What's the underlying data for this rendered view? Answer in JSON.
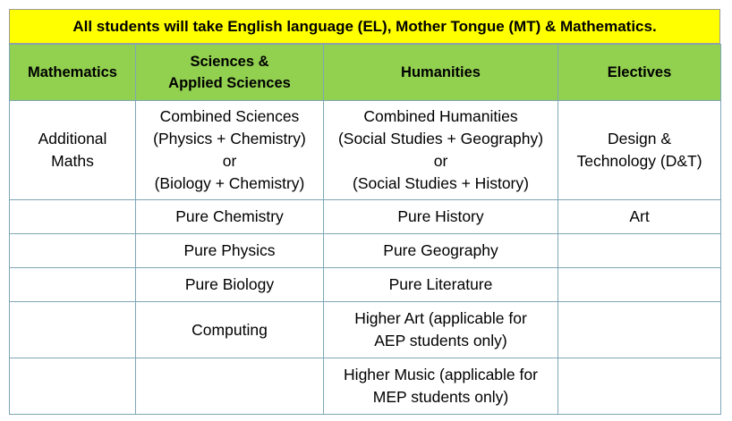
{
  "banner": {
    "text": "All students will take English language (EL), Mother Tongue (MT) & Mathematics."
  },
  "table": {
    "headers": {
      "mathematics": "Mathematics",
      "sciences_line1": "Sciences &",
      "sciences_line2": "Applied Sciences",
      "humanities": "Humanities",
      "electives": "Electives"
    },
    "rows": [
      {
        "mathematics": [
          "Additional",
          "Maths"
        ],
        "sciences": [
          "Combined Sciences",
          "(Physics + Chemistry)",
          "or",
          "(Biology + Chemistry)"
        ],
        "humanities": [
          "Combined Humanities",
          "(Social Studies + Geography)",
          "or",
          "(Social Studies + History)"
        ],
        "electives": [
          "Design &",
          "Technology (D&T)"
        ]
      },
      {
        "mathematics": "",
        "sciences": "Pure Chemistry",
        "humanities": "Pure History",
        "electives": "Art"
      },
      {
        "mathematics": "",
        "sciences": "Pure Physics",
        "humanities": "Pure Geography",
        "electives": ""
      },
      {
        "mathematics": "",
        "sciences": "Pure Biology",
        "humanities": "Pure Literature",
        "electives": ""
      },
      {
        "mathematics": "",
        "sciences": "Computing",
        "humanities": [
          "Higher Art (applicable for",
          "AEP students only)"
        ],
        "electives": ""
      },
      {
        "mathematics": "",
        "sciences": "",
        "humanities": [
          "Higher Music (applicable for",
          "MEP students only)"
        ],
        "electives": ""
      }
    ]
  },
  "colors": {
    "banner_background": "#ffff00",
    "header_background": "#92d050",
    "grid_border": "#7fa6b6"
  }
}
